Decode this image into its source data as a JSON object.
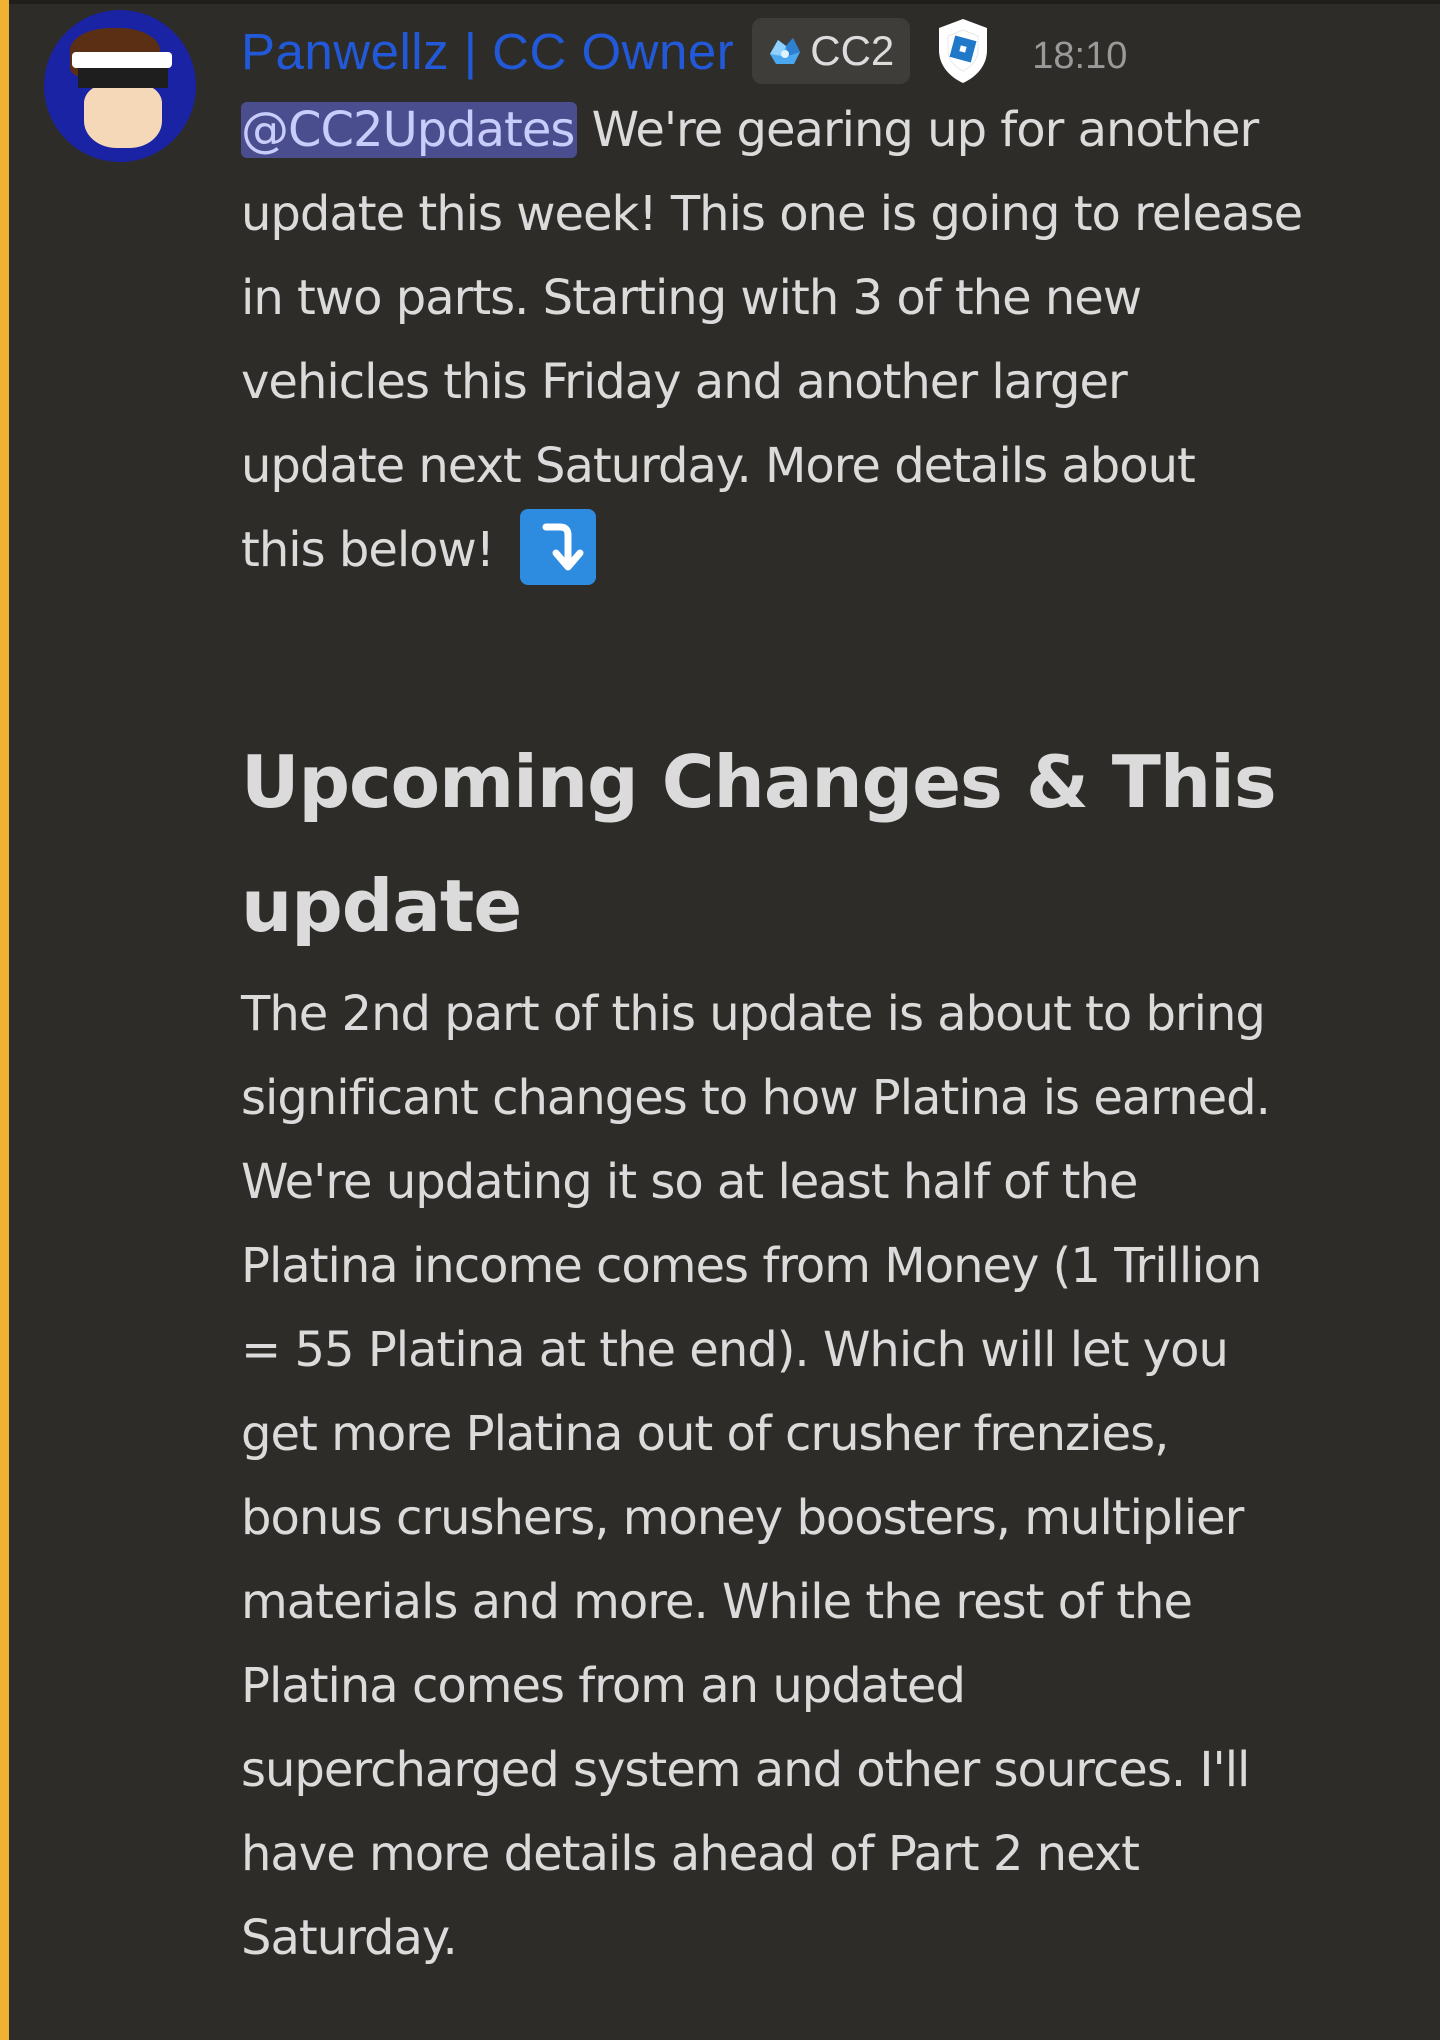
{
  "message": {
    "author": "Panwellz | CC Owner",
    "server_tag": "CC2",
    "timestamp": "18:10",
    "mention": "@CC2Updates",
    "intro_lines": [
      " We're gearing up for another",
      "update this week! This one is going to release",
      "in two parts. Starting with 3 of the new",
      "vehicles this Friday and another larger",
      "update next Saturday. More details about",
      "this below!"
    ],
    "emoji": "arrow-heading-down",
    "heading_lines": [
      "Upcoming Changes & This",
      "update"
    ],
    "body_lines": [
      "The 2nd part of this update is about to bring",
      "significant changes to how Platina is earned.",
      "We're updating it so at least half of the",
      "Platina income comes from Money (1 Trillion",
      "= 55 Platina at the end). Which will let you",
      "get more Platina out of crusher frenzies,",
      "bonus crushers, money boosters, multiplier",
      "materials and more. While the rest of the",
      "Platina comes from an updated",
      "supercharged system and other sources. I'll",
      "have more details ahead of Part 2 next",
      "Saturday."
    ]
  },
  "colors": {
    "background": "#2e2c28",
    "username": "#2159d8",
    "mention_highlight": "#f0b232",
    "mention_pill": "#4a4e8e",
    "text": "#dbdbdb"
  }
}
